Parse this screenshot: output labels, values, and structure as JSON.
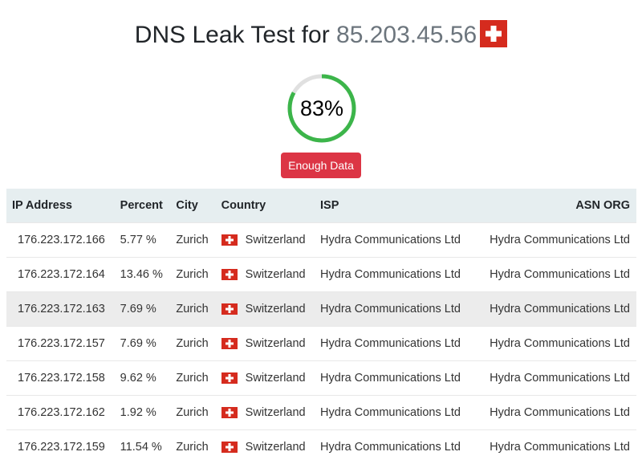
{
  "title": {
    "prefix": "DNS Leak Test for",
    "ip": "85.203.45.56",
    "flag": "switzerland-flag"
  },
  "score": {
    "label": "83%",
    "value": 83,
    "color": "#3cb54a",
    "track": "#e0e0e0"
  },
  "status_button": {
    "label": "Enough Data",
    "color": "#dc3545"
  },
  "table": {
    "headers": [
      "IP Address",
      "Percent",
      "City",
      "Country",
      "ISP",
      "ASN ORG"
    ],
    "rows": [
      {
        "ip": "176.223.172.166",
        "percent": "5.77 %",
        "city": "Zurich",
        "country": "Switzerland",
        "isp": "Hydra Communications Ltd",
        "asn": "Hydra Communications Ltd"
      },
      {
        "ip": "176.223.172.164",
        "percent": "13.46 %",
        "city": "Zurich",
        "country": "Switzerland",
        "isp": "Hydra Communications Ltd",
        "asn": "Hydra Communications Ltd"
      },
      {
        "ip": "176.223.172.163",
        "percent": "7.69 %",
        "city": "Zurich",
        "country": "Switzerland",
        "isp": "Hydra Communications Ltd",
        "asn": "Hydra Communications Ltd"
      },
      {
        "ip": "176.223.172.157",
        "percent": "7.69 %",
        "city": "Zurich",
        "country": "Switzerland",
        "isp": "Hydra Communications Ltd",
        "asn": "Hydra Communications Ltd"
      },
      {
        "ip": "176.223.172.158",
        "percent": "9.62 %",
        "city": "Zurich",
        "country": "Switzerland",
        "isp": "Hydra Communications Ltd",
        "asn": "Hydra Communications Ltd"
      },
      {
        "ip": "176.223.172.162",
        "percent": "1.92 %",
        "city": "Zurich",
        "country": "Switzerland",
        "isp": "Hydra Communications Ltd",
        "asn": "Hydra Communications Ltd"
      },
      {
        "ip": "176.223.172.159",
        "percent": "11.54 %",
        "city": "Zurich",
        "country": "Switzerland",
        "isp": "Hydra Communications Ltd",
        "asn": "Hydra Communications Ltd"
      }
    ]
  }
}
